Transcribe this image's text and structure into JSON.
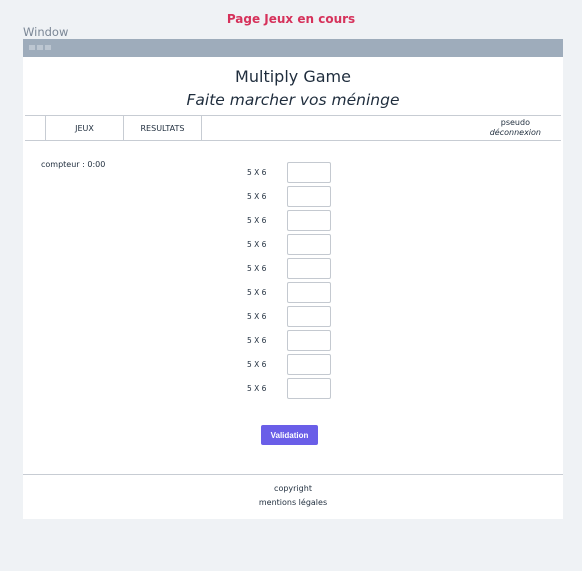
{
  "page": {
    "title": "Page Jeux en cours",
    "window_label": "Window"
  },
  "header": {
    "title": "Multiply Game",
    "subtitle": "Faite marcher vos méninge"
  },
  "nav": {
    "items": [
      {
        "label": "JEUX"
      },
      {
        "label": "RESULTATS"
      }
    ],
    "user": {
      "pseudo": "pseudo",
      "logout": "déconnexion"
    }
  },
  "game": {
    "counter": "compteur : 0:00",
    "questions": [
      {
        "label": "5 X 6",
        "value": ""
      },
      {
        "label": "5 X 6",
        "value": ""
      },
      {
        "label": "5 X 6",
        "value": ""
      },
      {
        "label": "5 X 6",
        "value": ""
      },
      {
        "label": "5 X 6",
        "value": ""
      },
      {
        "label": "5 X 6",
        "value": ""
      },
      {
        "label": "5 X 6",
        "value": ""
      },
      {
        "label": "5 X 6",
        "value": ""
      },
      {
        "label": "5 X 6",
        "value": ""
      },
      {
        "label": "5 X 6",
        "value": ""
      }
    ],
    "validate_label": "Validation"
  },
  "footer": {
    "copyright": "copyright",
    "legal": "mentions légales"
  },
  "colors": {
    "accent": "#6a5ee8",
    "page_title": "#d6325b",
    "titlebar": "#9eacbb"
  }
}
